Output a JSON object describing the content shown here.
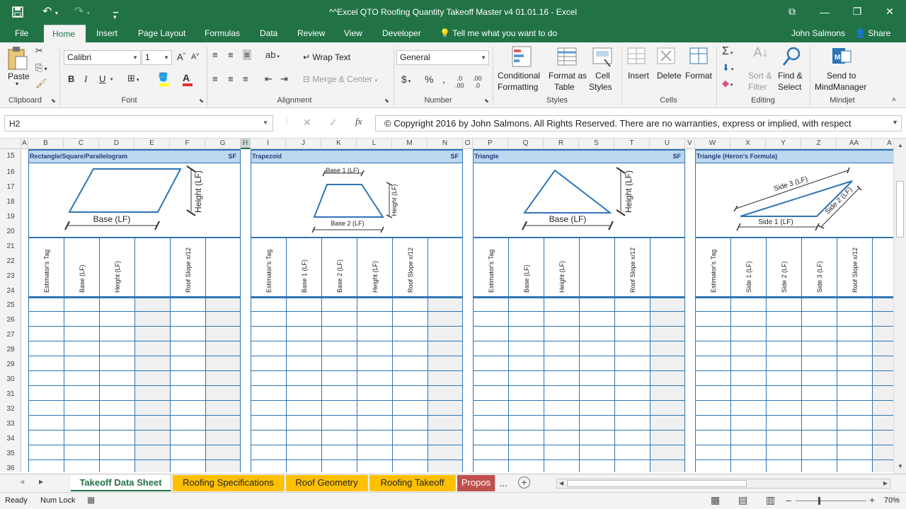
{
  "title": "^^Excel QTO Roofing Quantity Takeoff Master v4 01.01.16 - Excel",
  "ribbon_tabs": [
    "File",
    "Home",
    "Insert",
    "Page Layout",
    "Formulas",
    "Data",
    "Review",
    "View",
    "Developer"
  ],
  "tell_me": "Tell me what you want to do",
  "user": "John Salmons",
  "share": "Share",
  "clipboard": {
    "paste": "Paste",
    "label": "Clipboard"
  },
  "font": {
    "name": "Calibri",
    "size": "1",
    "label": "Font",
    "bold": "B",
    "italic": "I",
    "underline": "U"
  },
  "alignment": {
    "wrap": "Wrap Text",
    "merge": "Merge & Center",
    "label": "Alignment"
  },
  "number": {
    "format": "General",
    "label": "Number",
    "currency": "$",
    "percent": "%"
  },
  "styles": {
    "conditional1": "Conditional",
    "conditional2": "Formatting",
    "format_as1": "Format as",
    "format_as2": "Table",
    "cell1": "Cell",
    "cell2": "Styles",
    "label": "Styles"
  },
  "cells": {
    "insert": "Insert",
    "delete": "Delete",
    "format": "Format",
    "label": "Cells"
  },
  "editing": {
    "sort1": "Sort &",
    "sort2": "Filter",
    "find1": "Find &",
    "find2": "Select",
    "label": "Editing"
  },
  "mindjet": {
    "send1": "Send to",
    "send2": "MindManager",
    "label": "Mindjet"
  },
  "name_box": "H2",
  "formula": "© Copyright 2016 by John Salmons. All Rights Reserved. There are no warranties, express or implied, with respect",
  "columns": [
    "A",
    "B",
    "C",
    "D",
    "E",
    "F",
    "G",
    "H",
    "I",
    "J",
    "K",
    "L",
    "M",
    "N",
    "O",
    "P",
    "Q",
    "R",
    "S",
    "T",
    "U",
    "V",
    "W",
    "X",
    "Y",
    "Z",
    "AA",
    "A"
  ],
  "rows": [
    "15",
    "16",
    "17",
    "18",
    "19",
    "20",
    "21",
    "22",
    "23",
    "24",
    "25",
    "26",
    "27",
    "28",
    "29",
    "30",
    "31",
    "32",
    "33",
    "34",
    "35",
    "36"
  ],
  "panels": [
    {
      "title": "Rectangle/Square/Parallelogram",
      "unit": "SF",
      "headers": [
        "Estimator's Tag",
        "Base (LF)",
        "Height (LF)",
        "",
        "Roof Slope x/12"
      ],
      "labels": [
        "Base (LF)",
        "Height (LF)"
      ]
    },
    {
      "title": "Trapezoid",
      "unit": "SF",
      "headers": [
        "Estimator's Tag",
        "Base 1 (LF)",
        "Base 2 (LF)",
        "Height (LF)",
        "Roof Slope x/12"
      ],
      "labels": [
        "Base 1 (LF)",
        "Base 2 (LF)",
        "Height (LF)"
      ]
    },
    {
      "title": "Triangle",
      "unit": "SF",
      "headers": [
        "Estimator's Tag",
        "Base (LF)",
        "Height (LF)",
        "",
        "Roof Slope x/12"
      ],
      "labels": [
        "Base (LF)",
        "Height (LF)"
      ]
    },
    {
      "title": "Triangle (Heron's Formula)",
      "unit": "SF",
      "headers": [
        "Estimator's Tag",
        "Side 1 (LF)",
        "Side 2 (LF)",
        "Side 3 (LF)",
        "Roof Slope x/12"
      ],
      "labels": [
        "Side 1 (LF)",
        "Side 2 (LF)",
        "Side 3 (LF)"
      ]
    }
  ],
  "sheet_tabs": [
    "Takeoff Data Sheet",
    "Roofing Specifications",
    "Roof Geometry",
    "Roofing Takeoff",
    "Propos"
  ],
  "sheet_more": "...",
  "status": {
    "ready": "Ready",
    "numlock": "Num Lock",
    "zoom": "70%"
  },
  "colors": {
    "excel_green": "#217346",
    "blue_border": "#2e75b6",
    "header_fill": "#bdd7ee",
    "tab_orange": "#ffc000",
    "tab_red": "#c0504d"
  }
}
